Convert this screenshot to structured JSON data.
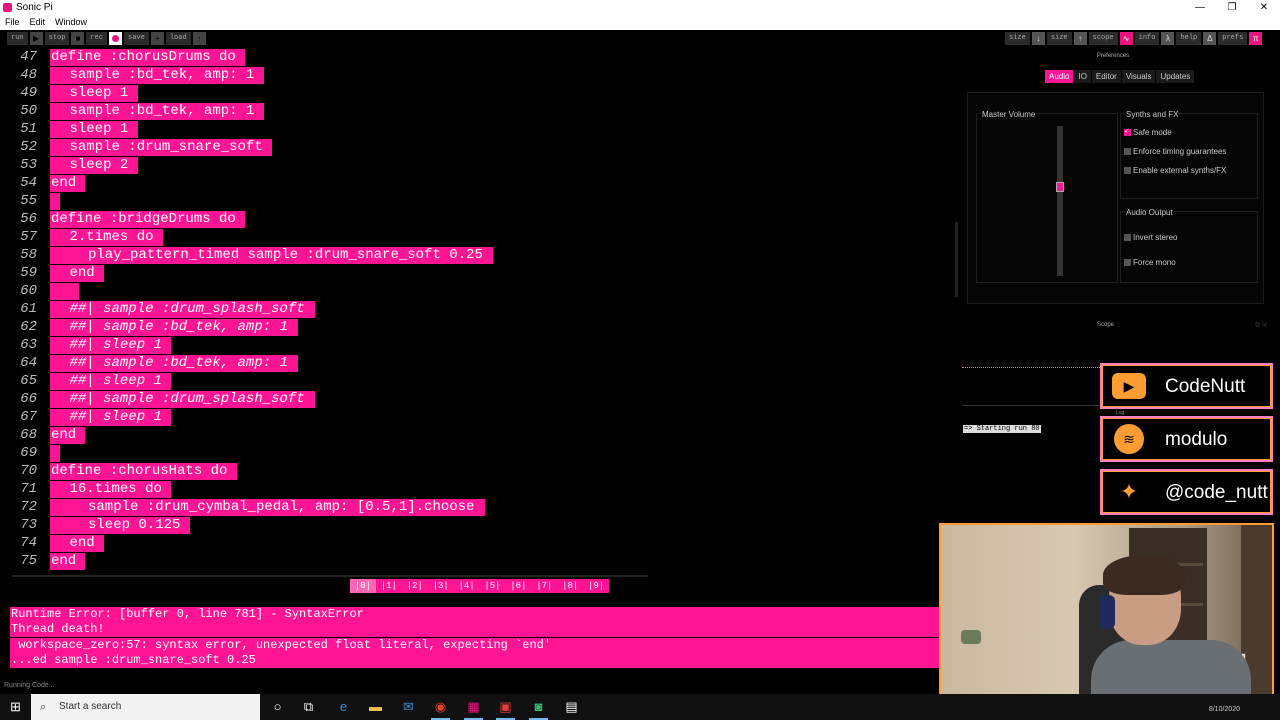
{
  "window": {
    "title": "Sonic Pi",
    "minimize": "—",
    "maximize": "❐",
    "close": "✕"
  },
  "menu": [
    "File",
    "Edit",
    "Window"
  ],
  "toolbar": {
    "left": [
      {
        "label": "run",
        "icon": "▶"
      },
      {
        "label": "stop",
        "icon": "■"
      },
      {
        "label": "rec",
        "icon": "●"
      },
      {
        "label": "save",
        "icon": "+"
      },
      {
        "label": "load",
        "icon": "↑"
      }
    ],
    "right": [
      {
        "label": "size",
        "icon": "↓"
      },
      {
        "label": "size",
        "icon": "↑"
      },
      {
        "label": "scope",
        "icon": "∿"
      },
      {
        "label": "info",
        "icon": "λ"
      },
      {
        "label": "help",
        "icon": "Δ"
      },
      {
        "label": "prefs",
        "icon": "π"
      }
    ]
  },
  "editor": {
    "lines": [
      {
        "n": "47",
        "indent": 0,
        "text": "define :chorusDrums do",
        "comment": false
      },
      {
        "n": "48",
        "indent": 1,
        "text": "sample :bd_tek, amp: 1",
        "comment": false
      },
      {
        "n": "49",
        "indent": 1,
        "text": "sleep 1",
        "comment": false
      },
      {
        "n": "50",
        "indent": 1,
        "text": "sample :bd_tek, amp: 1",
        "comment": false
      },
      {
        "n": "51",
        "indent": 1,
        "text": "sleep 1",
        "comment": false
      },
      {
        "n": "52",
        "indent": 1,
        "text": "sample :drum_snare_soft",
        "comment": false
      },
      {
        "n": "53",
        "indent": 1,
        "text": "sleep 2",
        "comment": false
      },
      {
        "n": "54",
        "indent": 0,
        "text": "end",
        "comment": false
      },
      {
        "n": "55",
        "indent": 0,
        "text": "",
        "comment": false
      },
      {
        "n": "56",
        "indent": 0,
        "text": "define :bridgeDrums do",
        "comment": false
      },
      {
        "n": "57",
        "indent": 1,
        "text": "2.times do",
        "comment": false
      },
      {
        "n": "58",
        "indent": 2,
        "text": "play_pattern_timed sample :drum_snare_soft 0.25",
        "comment": false
      },
      {
        "n": "59",
        "indent": 1,
        "text": "end",
        "comment": false
      },
      {
        "n": "60",
        "indent": 1,
        "text": "",
        "comment": false
      },
      {
        "n": "61",
        "indent": 1,
        "text": "##| sample :drum_splash_soft",
        "comment": true
      },
      {
        "n": "62",
        "indent": 1,
        "text": "##| sample :bd_tek, amp: 1",
        "comment": true
      },
      {
        "n": "63",
        "indent": 1,
        "text": "##| sleep 1",
        "comment": true
      },
      {
        "n": "64",
        "indent": 1,
        "text": "##| sample :bd_tek, amp: 1",
        "comment": true
      },
      {
        "n": "65",
        "indent": 1,
        "text": "##| sleep 1",
        "comment": true
      },
      {
        "n": "66",
        "indent": 1,
        "text": "##| sample :drum_splash_soft",
        "comment": true
      },
      {
        "n": "67",
        "indent": 1,
        "text": "##| sleep 1",
        "comment": true
      },
      {
        "n": "68",
        "indent": 0,
        "text": "end",
        "comment": false
      },
      {
        "n": "69",
        "indent": 0,
        "text": "",
        "comment": false
      },
      {
        "n": "70",
        "indent": 0,
        "text": "define :chorusHats do",
        "comment": false
      },
      {
        "n": "71",
        "indent": 1,
        "text": "16.times do",
        "comment": false
      },
      {
        "n": "72",
        "indent": 2,
        "text": "sample :drum_cymbal_pedal, amp: [0.5,1].choose",
        "comment": false
      },
      {
        "n": "73",
        "indent": 2,
        "text": "sleep 0.125",
        "comment": false
      },
      {
        "n": "74",
        "indent": 1,
        "text": "end",
        "comment": false
      },
      {
        "n": "75",
        "indent": 0,
        "text": "end",
        "comment": false
      }
    ]
  },
  "buffers": {
    "tabs": [
      "|0|",
      "|1|",
      "|2|",
      "|3|",
      "|4|",
      "|5|",
      "|6|",
      "|7|",
      "|8|",
      "|9|"
    ],
    "active": 0
  },
  "errors": [
    "Runtime Error: [buffer 0, line 781] - SyntaxError",
    "Thread death!",
    " workspace_zero:57: syntax error, unexpected float literal, expecting `end'",
    "...ed sample :drum_snare_soft 0.25"
  ],
  "status": "Running Code...",
  "prefs": {
    "title": "Preferences",
    "tabs": [
      "Audio",
      "IO",
      "Editor",
      "Visuals",
      "Updates"
    ],
    "active_tab": 0,
    "master_volume_label": "Master Volume",
    "master_volume_level": 0.6,
    "synths_title": "Synths and FX",
    "synths_options": [
      {
        "label": "Safe mode",
        "checked": true
      },
      {
        "label": "Enforce timing guarantees",
        "checked": false
      },
      {
        "label": "Enable external synths/FX",
        "checked": false
      }
    ],
    "output_title": "Audio Output",
    "output_options": [
      {
        "label": "Invert stereo",
        "checked": false
      },
      {
        "label": "Force mono",
        "checked": false
      }
    ]
  },
  "scope": {
    "title": "Scope"
  },
  "log": {
    "title": "Log",
    "entry": "=> Starting run 80"
  },
  "social": [
    {
      "icon": "youtube-icon",
      "glyph": "▶",
      "text": "CodeNutt"
    },
    {
      "icon": "spotify-icon",
      "glyph": "≋",
      "text": "modulo"
    },
    {
      "icon": "twitter-icon",
      "glyph": "✦",
      "text": "@code_nutt"
    }
  ],
  "taskbar": {
    "search_placeholder": "Start a search",
    "clock": "8/10/2020"
  },
  "colors": {
    "accent": "#ff1493",
    "overlay": "#ff9d33"
  }
}
